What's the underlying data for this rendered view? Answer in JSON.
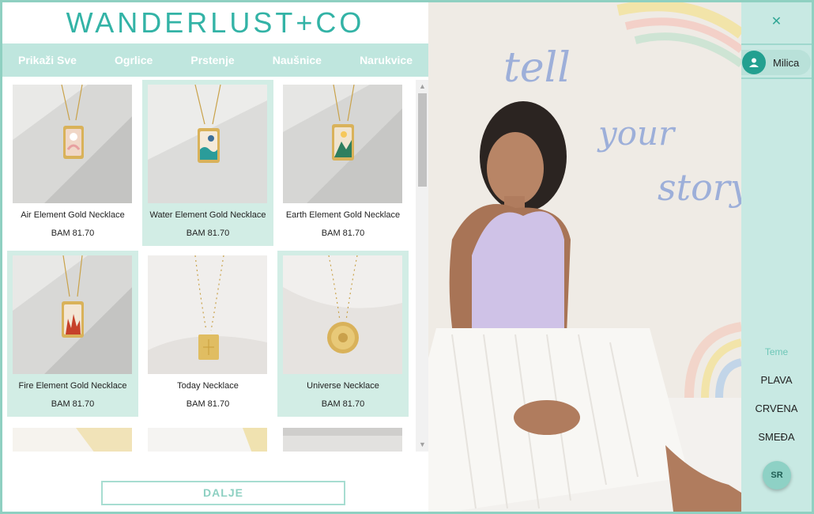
{
  "brand": {
    "logo_text": "WANDERLUST+CO",
    "accent": "#33b3a6"
  },
  "nav": {
    "items": [
      "Prikaži Sve",
      "Ogrlice",
      "Prstenje",
      "Naušnice",
      "Narukvice"
    ]
  },
  "products": [
    {
      "name": "Air Element Gold Necklace",
      "price": "BAM 81.70",
      "highlighted": false
    },
    {
      "name": "Water Element Gold Necklace",
      "price": "BAM 81.70",
      "highlighted": true
    },
    {
      "name": "Earth Element Gold Necklace",
      "price": "BAM 81.70",
      "highlighted": false
    },
    {
      "name": "Fire Element Gold Necklace",
      "price": "BAM 81.70",
      "highlighted": true
    },
    {
      "name": "Today Necklace",
      "price": "BAM 81.70",
      "highlighted": false
    },
    {
      "name": "Universe Necklace",
      "price": "BAM 81.70",
      "highlighted": true
    }
  ],
  "pagination": {
    "next_label": "DALJE"
  },
  "sidebar": {
    "close_icon": "close-icon",
    "user": {
      "name": "Milica",
      "icon": "person-icon"
    },
    "themes_label": "Teme",
    "themes": [
      "PLAVA",
      "CRVENA",
      "SMEĐA"
    ],
    "language": "SR"
  }
}
